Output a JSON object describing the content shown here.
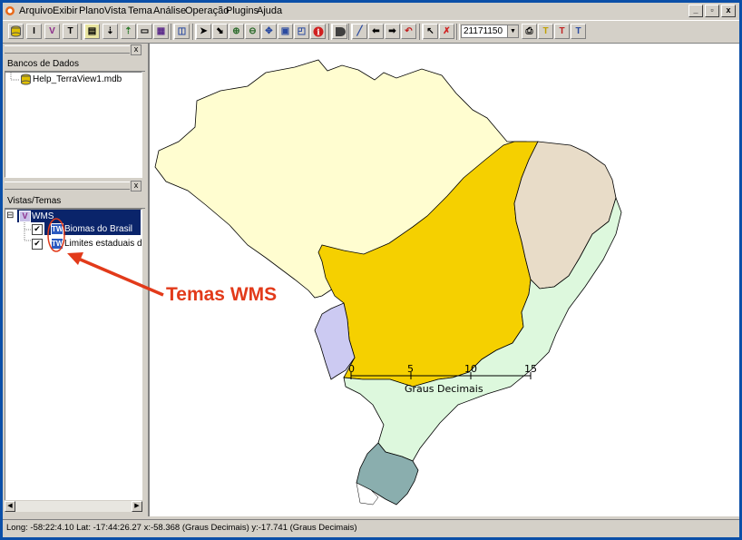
{
  "menu": [
    "Arquivo",
    "Exibir",
    "Plano",
    "Vista",
    "Tema",
    "Análise",
    "Operação",
    "Plugins",
    "Ajuda"
  ],
  "window_controls": [
    "_",
    "▫",
    "x"
  ],
  "toolbar": {
    "scale_value": "21171150",
    "icons": [
      "database-icon",
      "info-i-icon",
      "view-v-icon",
      "theme-t-icon",
      "connect-db-icon",
      "import-icon",
      "export-icon",
      "window-icon",
      "grid-icon",
      "table-icon",
      "pointer-icon",
      "select-icon",
      "zoom-in-icon",
      "zoom-out-icon",
      "pan-icon",
      "zoom-area-icon",
      "zoom-extent-icon",
      "info-icon",
      "shape-icon",
      "draw-line-icon",
      "back-arrow-icon",
      "forward-arrow-icon",
      "undo-icon",
      "select-pointer-icon",
      "clear-select-icon",
      "print-icon",
      "text-theme-icon",
      "text-theme-2-icon",
      "text-view-icon"
    ]
  },
  "databases_panel": {
    "title": "Bancos de Dados",
    "items": [
      "Help_TerraView1.mdb"
    ]
  },
  "views_panel": {
    "title": "Vistas/Temas",
    "view": "WMS",
    "themes": [
      "Biomas do Brasil",
      "Limites estaduais do Brasil"
    ],
    "collapse_glyph": "⊟"
  },
  "map": {
    "scale_ticks": [
      "0",
      "5",
      "10",
      "15"
    ],
    "scale_unit": "Graus Decimais",
    "colors": {
      "amazonia": "#fffdd0",
      "cerrado": "#f5d000",
      "caatinga": "#e8dcc8",
      "pantanal": "#cccaf2",
      "mata_atlantica": "#ddf8dd",
      "pampa": "#8aaeae"
    }
  },
  "annotation": {
    "label": "Temas WMS",
    "color": "#e23a1a"
  },
  "status": "Long: -58:22:4.10 Lat: -17:44:26.27  x:-58.368 (Graus Decimais)  y:-17.741 (Graus Decimais)"
}
